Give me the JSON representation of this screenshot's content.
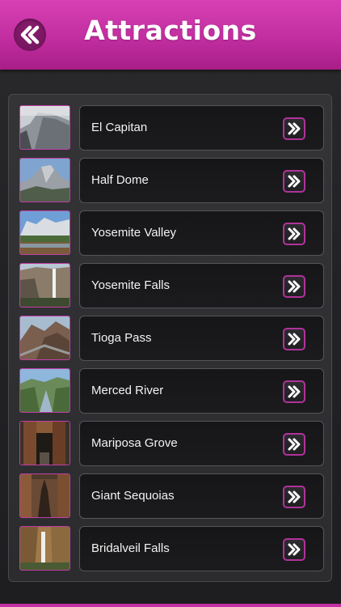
{
  "header": {
    "title": "Attractions",
    "back_icon": "double-chevron-left-icon",
    "accent": "#c530a5"
  },
  "attractions": [
    {
      "name": "El Capitan",
      "thumb": "el-capitan-photo",
      "arrow_icon": "double-chevron-right-icon"
    },
    {
      "name": "Half Dome",
      "thumb": "half-dome-photo",
      "arrow_icon": "double-chevron-right-icon"
    },
    {
      "name": "Yosemite Valley",
      "thumb": "yosemite-valley-photo",
      "arrow_icon": "double-chevron-right-icon"
    },
    {
      "name": "Yosemite Falls",
      "thumb": "yosemite-falls-photo",
      "arrow_icon": "double-chevron-right-icon"
    },
    {
      "name": "Tioga Pass",
      "thumb": "tioga-pass-photo",
      "arrow_icon": "double-chevron-right-icon"
    },
    {
      "name": "Merced River",
      "thumb": "merced-river-photo",
      "arrow_icon": "double-chevron-right-icon"
    },
    {
      "name": "Mariposa Grove",
      "thumb": "mariposa-grove-photo",
      "arrow_icon": "double-chevron-right-icon"
    },
    {
      "name": "Giant Sequoias",
      "thumb": "giant-sequoias-photo",
      "arrow_icon": "double-chevron-right-icon"
    },
    {
      "name": "Bridalveil Falls",
      "thumb": "bridalveil-falls-photo",
      "arrow_icon": "double-chevron-right-icon"
    }
  ]
}
